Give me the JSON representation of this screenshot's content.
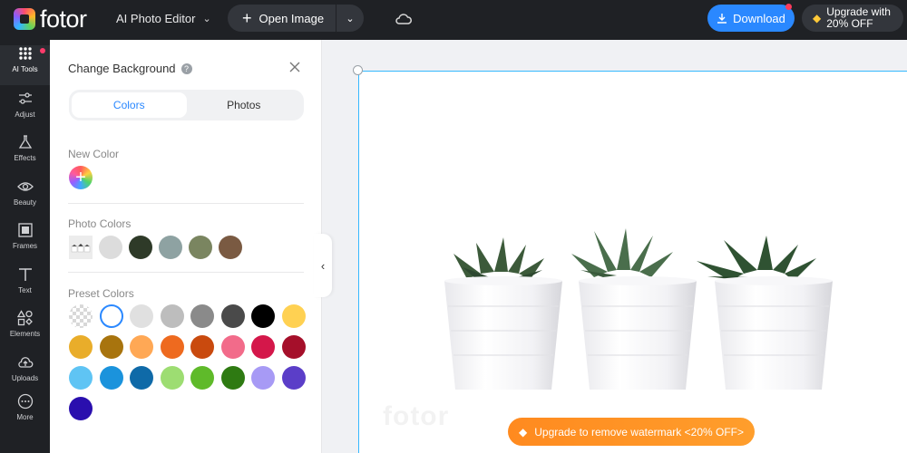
{
  "header": {
    "logo_text": "fotor",
    "editor_label": "AI Photo Editor",
    "open_image_label": "Open Image",
    "download_label": "Download",
    "upgrade_line1": "Upgrade with",
    "upgrade_line2": "20% OFF"
  },
  "rail": {
    "items": [
      {
        "label": "AI Tools",
        "icon": "grid-icon"
      },
      {
        "label": "Adjust",
        "icon": "sliders-icon"
      },
      {
        "label": "Effects",
        "icon": "flask-icon"
      },
      {
        "label": "Beauty",
        "icon": "eye-icon"
      },
      {
        "label": "Frames",
        "icon": "frame-icon"
      },
      {
        "label": "Text",
        "icon": "text-icon"
      },
      {
        "label": "Elements",
        "icon": "shapes-icon"
      },
      {
        "label": "Uploads",
        "icon": "cloud-upload-icon"
      },
      {
        "label": "More",
        "icon": "more-icon"
      }
    ]
  },
  "panel": {
    "title": "Change Background",
    "tabs": [
      {
        "label": "Colors",
        "active": true
      },
      {
        "label": "Photos",
        "active": false
      }
    ],
    "new_color_label": "New Color",
    "photo_colors_label": "Photo Colors",
    "photo_colors": [
      "#dcdcdc",
      "#2e3a28",
      "#8ea2a2",
      "#7a8560",
      "#7a5a42"
    ],
    "preset_colors_label": "Preset Colors",
    "preset_colors": [
      "transparent",
      "#ffffff",
      "#e0e0e0",
      "#bdbdbd",
      "#8a8a8a",
      "#4a4a4a",
      "#000000",
      "#ffd152",
      "#e9ad2a",
      "#a8740e",
      "#ffa855",
      "#ee6a1f",
      "#c94a0e",
      "#f26b8a",
      "#d4174a",
      "#a50f2a",
      "#5fc4f4",
      "#1b93dc",
      "#0f6aa8",
      "#9ddd72",
      "#5fba2a",
      "#2e7a12",
      "#a79af5",
      "#5b3ec8",
      "#2a0fae"
    ]
  },
  "canvas": {
    "watermark_text": "fotor",
    "banner_label": "Upgrade to remove watermark <20% OFF>"
  },
  "colors": {
    "accent": "#2a88ff",
    "canvas_border": "#35b8ff",
    "banner": "#ff8a1f"
  }
}
